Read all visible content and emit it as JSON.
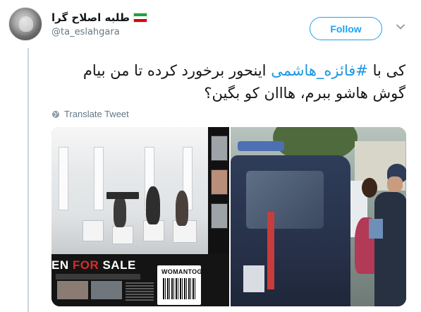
{
  "author": {
    "display_name": "طلبه اصلاح گرا",
    "handle": "@ta_eslahgara",
    "flag_colors": [
      "#239f40",
      "#ffffff",
      "#da0000"
    ]
  },
  "follow_label": "Follow",
  "tweet": {
    "line1_prefix": "کی با ",
    "hashtag": "#فائزه_هاشمی",
    "line1_suffix": " اینحور برخورد کرده تا من بیام",
    "line2": "گوش هاشو ببرم، هااان کو بگین؟"
  },
  "translate_label": "Translate Tweet",
  "media": {
    "left_image": {
      "sale_prefix": "EN ",
      "sale_red": "FOR",
      "sale_suffix": " SALE",
      "logo_text": "WOMANTOGO"
    }
  },
  "colors": {
    "accent": "#1da1f2",
    "hashtag": "#1b95e0",
    "muted": "#657786",
    "text": "#14171a"
  }
}
